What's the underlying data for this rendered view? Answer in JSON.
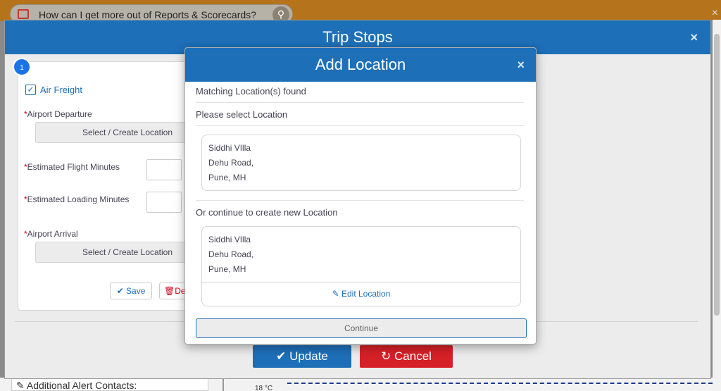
{
  "background": {
    "search_text": "How can I get more out of Reports & Scorecards?",
    "close_glyph": "×",
    "alert_contacts_label": "Additional Alert Contacts:",
    "temp_text": "18 °C"
  },
  "trip_modal": {
    "title": "Trip Stops",
    "close_glyph": "×",
    "stop": {
      "number": "1",
      "air_freight_label": "Air Freight",
      "airport_departure_label": "Airport Departure",
      "select_create_label": "Select / Create Location",
      "flight_minutes_label": "Estimated Flight Minutes",
      "loading_minutes_label": "Estimated Loading Minutes",
      "airport_arrival_label": "Airport Arrival",
      "select_create_label_2": "Select / Create Location",
      "save_label": "Save",
      "delete_label": "De"
    },
    "update_label": "Update",
    "cancel_label": "Cancel"
  },
  "add_location_modal": {
    "title": "Add Location",
    "close_glyph": "×",
    "matching_text": "Matching Location(s) found",
    "please_select_text": "Please select Location",
    "matched_address": [
      "Siddhi VIlla",
      "Dehu Road,",
      "Pune, MH"
    ],
    "or_continue_text": "Or continue to create new Location",
    "new_address": [
      "Siddhi VIlla",
      "Dehu Road,",
      "Pune, MH"
    ],
    "edit_location_label": "Edit Location",
    "continue_label": "Continue"
  },
  "colors": {
    "primary": "#1d6fb8",
    "danger": "#d62027",
    "topbar": "#b5731b"
  }
}
